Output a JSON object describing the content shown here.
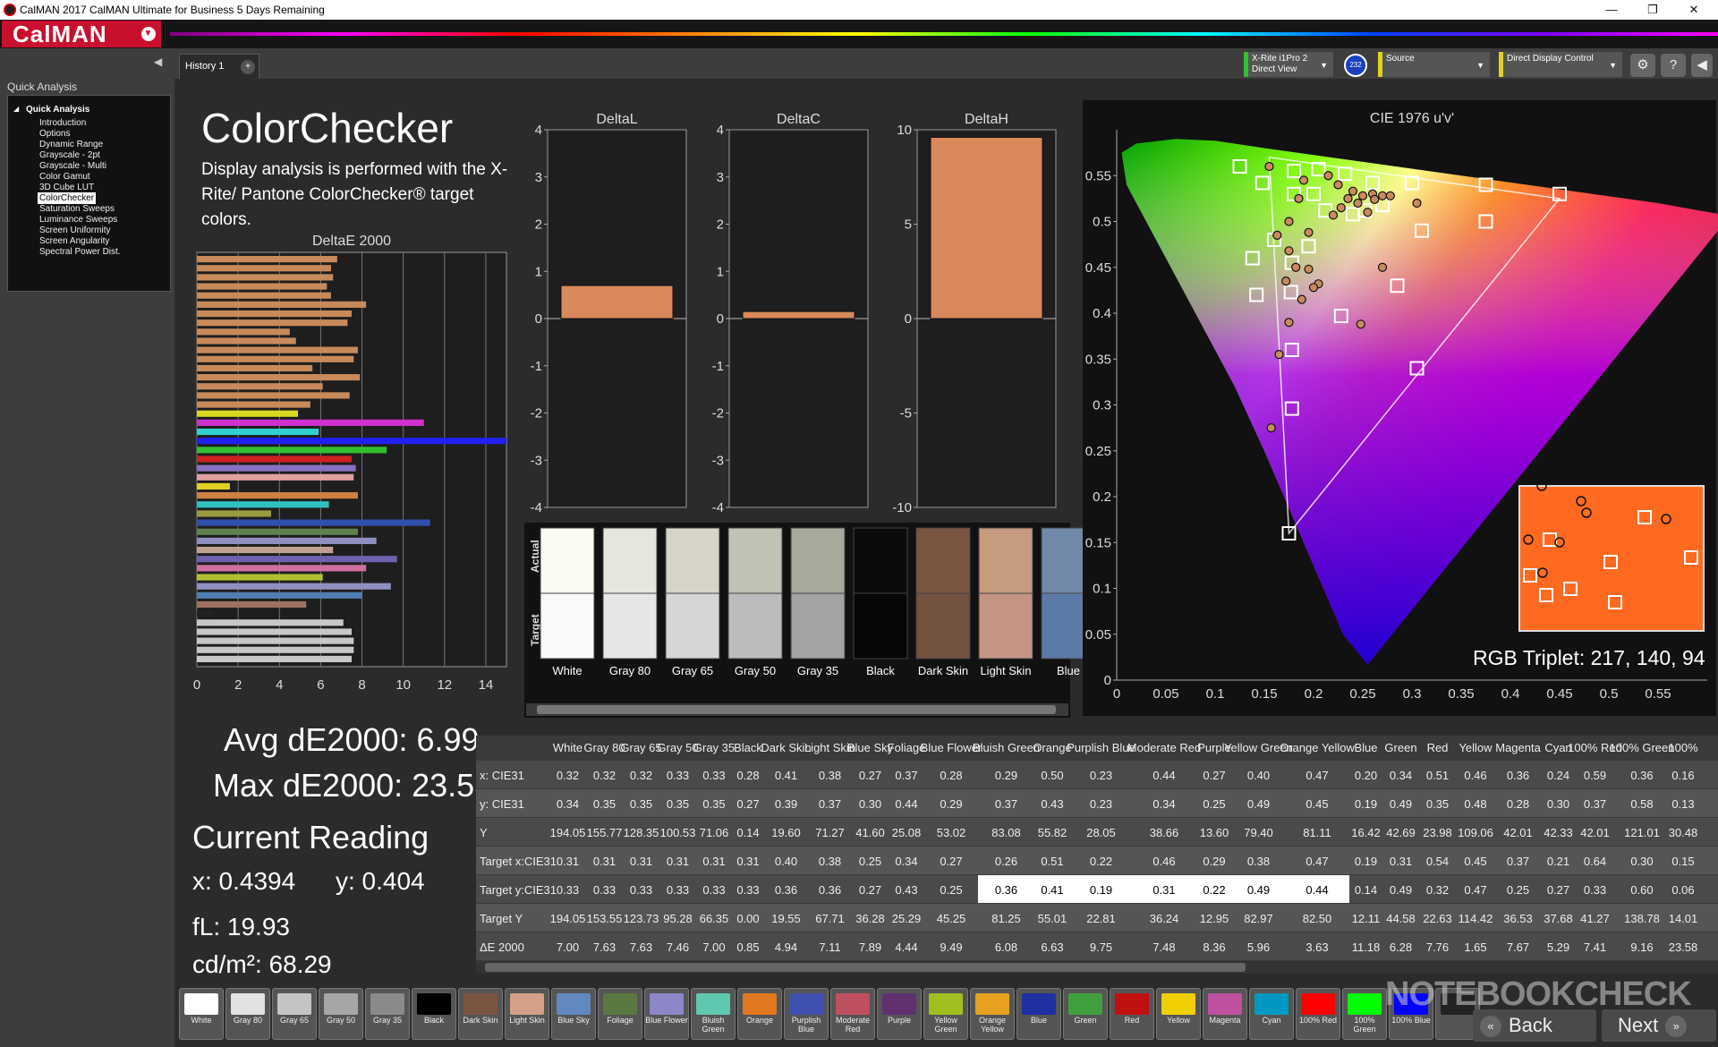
{
  "window": {
    "title": "CalMAN 2017 CalMAN Ultimate for Business 5 Days Remaining",
    "controls": [
      "—",
      "❐",
      "✕"
    ]
  },
  "logo": {
    "text": "CalMAN",
    "dropdown": "▼"
  },
  "sidebar": {
    "header": "Quick Analysis",
    "collapse": "◀",
    "root": "Quick Analysis",
    "items": [
      {
        "label": "Introduction"
      },
      {
        "label": "Options"
      },
      {
        "label": "Dynamic Range"
      },
      {
        "label": "Grayscale - 2pt"
      },
      {
        "label": "Grayscale - Multi"
      },
      {
        "label": "Color Gamut"
      },
      {
        "label": "3D Cube LUT"
      },
      {
        "label": "ColorChecker",
        "selected": true
      },
      {
        "label": "Saturation Sweeps"
      },
      {
        "label": "Luminance Sweeps"
      },
      {
        "label": "Screen Uniformity"
      },
      {
        "label": "Screen Angularity"
      },
      {
        "label": "Spectral Power Dist."
      }
    ]
  },
  "tabs": [
    {
      "label": "History 1"
    }
  ],
  "toolbar": {
    "meter": {
      "line1": "X-Rite i1Pro 2",
      "line2": "Direct View"
    },
    "badge": "232",
    "source": "Source",
    "display": "Direct Display Control",
    "buttons": [
      "⚙",
      "?",
      "◀"
    ]
  },
  "page": {
    "title": "ColorChecker",
    "description": "Display analysis is performed with the X-Rite/ Pantone ColorChecker® target colors."
  },
  "stats": {
    "avg": "Avg dE2000: 6.99",
    "max": "Max dE2000: 23.58",
    "current_heading": "Current Reading",
    "x": "x: 0.4394",
    "y": "y: 0.404",
    "fl": "fL: 19.93",
    "cdm2": "cd/m²: 68.29"
  },
  "chart_data": [
    {
      "type": "bar",
      "title": "DeltaE 2000",
      "orientation": "horizontal",
      "xlim": [
        0,
        15
      ],
      "xticks": [
        0,
        2,
        4,
        6,
        8,
        10,
        12,
        14
      ],
      "bars": [
        {
          "color": "#c88a5a",
          "value": 6.8
        },
        {
          "color": "#c88a5a",
          "value": 6.5
        },
        {
          "color": "#c88a5a",
          "value": 6.6
        },
        {
          "color": "#c88a5a",
          "value": 6.3
        },
        {
          "color": "#c88a5a",
          "value": 6.5
        },
        {
          "color": "#c88a5a",
          "value": 8.2
        },
        {
          "color": "#c88a5a",
          "value": 7.5
        },
        {
          "color": "#c88a5a",
          "value": 7.3
        },
        {
          "color": "#c88a5a",
          "value": 4.5
        },
        {
          "color": "#c88a5a",
          "value": 4.8
        },
        {
          "color": "#c88a5a",
          "value": 7.8
        },
        {
          "color": "#c88a5a",
          "value": 7.6
        },
        {
          "color": "#c88a5a",
          "value": 5.6
        },
        {
          "color": "#c88a5a",
          "value": 7.9
        },
        {
          "color": "#c88a5a",
          "value": 6.1
        },
        {
          "color": "#c88a5a",
          "value": 7.4
        },
        {
          "color": "#c88a5a",
          "value": 5.5
        },
        {
          "color": "#d8d820",
          "value": 4.9
        },
        {
          "color": "#d030d0",
          "value": 11.0
        },
        {
          "color": "#30d0d0",
          "value": 5.9
        },
        {
          "color": "#2020f0",
          "value": 15.0
        },
        {
          "color": "#30c030",
          "value": 9.2
        },
        {
          "color": "#d02020",
          "value": 7.5
        },
        {
          "color": "#8a70c0",
          "value": 7.7
        },
        {
          "color": "#e0a0a0",
          "value": 7.6
        },
        {
          "color": "#e0d020",
          "value": 1.6
        },
        {
          "color": "#d08040",
          "value": 7.8
        },
        {
          "color": "#30c0c0",
          "value": 6.4
        },
        {
          "color": "#9a9a40",
          "value": 3.6
        },
        {
          "color": "#3050b0",
          "value": 11.3
        },
        {
          "color": "#608050",
          "value": 7.8
        },
        {
          "color": "#9090c0",
          "value": 8.7
        },
        {
          "color": "#c0a090",
          "value": 6.6
        },
        {
          "color": "#7060b0",
          "value": 9.7
        },
        {
          "color": "#d070a0",
          "value": 8.2
        },
        {
          "color": "#b0c030",
          "value": 6.1
        },
        {
          "color": "#9090c0",
          "value": 9.4
        },
        {
          "color": "#5080b0",
          "value": 8.0
        },
        {
          "color": "#a07060",
          "value": 5.3
        },
        {
          "color": "#222222",
          "value": 0.8
        },
        {
          "color": "#c8c8c8",
          "value": 7.1
        },
        {
          "color": "#c8c8c8",
          "value": 7.5
        },
        {
          "color": "#c8c8c8",
          "value": 7.6
        },
        {
          "color": "#c8c8c8",
          "value": 7.6
        },
        {
          "color": "#c8c8c8",
          "value": 7.5
        }
      ]
    },
    {
      "type": "bar",
      "title": "DeltaL",
      "ylim": [
        -4,
        4
      ],
      "yticks": [
        4,
        3,
        2,
        1,
        0,
        -1,
        -2,
        -3,
        -4
      ],
      "values": [
        0.7
      ]
    },
    {
      "type": "bar",
      "title": "DeltaC",
      "ylim": [
        -4,
        4
      ],
      "yticks": [
        4,
        3,
        2,
        1,
        0,
        -1,
        -2,
        -3,
        -4
      ],
      "values": [
        0.15
      ]
    },
    {
      "type": "bar",
      "title": "DeltaH",
      "ylim": [
        -10,
        10
      ],
      "yticks": [
        10,
        5,
        0,
        -5,
        -10
      ],
      "values": [
        9.6
      ]
    },
    {
      "type": "scatter",
      "title": "CIE 1976 u'v'",
      "xlim": [
        0,
        0.6
      ],
      "ylim": [
        0,
        0.6
      ],
      "xticks": [
        "0",
        "0.05",
        "0.1",
        "0.15",
        "0.2",
        "0.25",
        "0.3",
        "0.35",
        "0.4",
        "0.45",
        "0.5",
        "0.55"
      ],
      "yticks": [
        "0.55",
        "0.5",
        "0.45",
        "0.4",
        "0.35",
        "0.3",
        "0.25",
        "0.2",
        "0.15",
        "0.1",
        "0.05",
        "0"
      ],
      "targets": [
        [
          0.125,
          0.56
        ],
        [
          0.18,
          0.555
        ],
        [
          0.205,
          0.557
        ],
        [
          0.232,
          0.552
        ],
        [
          0.26,
          0.542
        ],
        [
          0.3,
          0.542
        ],
        [
          0.375,
          0.54
        ],
        [
          0.45,
          0.53
        ],
        [
          0.148,
          0.542
        ],
        [
          0.18,
          0.53
        ],
        [
          0.2,
          0.53
        ],
        [
          0.212,
          0.512
        ],
        [
          0.24,
          0.508
        ],
        [
          0.252,
          0.512
        ],
        [
          0.27,
          0.518
        ],
        [
          0.31,
          0.49
        ],
        [
          0.375,
          0.5
        ],
        [
          0.16,
          0.48
        ],
        [
          0.138,
          0.46
        ],
        [
          0.178,
          0.455
        ],
        [
          0.195,
          0.473
        ],
        [
          0.142,
          0.42
        ],
        [
          0.177,
          0.423
        ],
        [
          0.285,
          0.43
        ],
        [
          0.228,
          0.397
        ],
        [
          0.178,
          0.36
        ],
        [
          0.305,
          0.34
        ],
        [
          0.178,
          0.296
        ],
        [
          0.175,
          0.16
        ]
      ],
      "actual": [
        [
          0.155,
          0.56
        ],
        [
          0.19,
          0.545
        ],
        [
          0.215,
          0.55
        ],
        [
          0.225,
          0.54
        ],
        [
          0.24,
          0.533
        ],
        [
          0.26,
          0.53
        ],
        [
          0.27,
          0.528
        ],
        [
          0.305,
          0.52
        ],
        [
          0.228,
          0.515
        ],
        [
          0.235,
          0.525
        ],
        [
          0.245,
          0.52
        ],
        [
          0.25,
          0.528
        ],
        [
          0.262,
          0.524
        ],
        [
          0.255,
          0.51
        ],
        [
          0.278,
          0.528
        ],
        [
          0.185,
          0.525
        ],
        [
          0.22,
          0.507
        ],
        [
          0.175,
          0.5
        ],
        [
          0.163,
          0.485
        ],
        [
          0.195,
          0.488
        ],
        [
          0.175,
          0.468
        ],
        [
          0.182,
          0.45
        ],
        [
          0.195,
          0.448
        ],
        [
          0.27,
          0.45
        ],
        [
          0.205,
          0.432
        ],
        [
          0.172,
          0.435
        ],
        [
          0.2,
          0.428
        ],
        [
          0.188,
          0.415
        ],
        [
          0.175,
          0.39
        ],
        [
          0.248,
          0.388
        ],
        [
          0.165,
          0.355
        ],
        [
          0.157,
          0.275
        ]
      ],
      "annotation": "RGB Triplet: 217, 140, 94"
    }
  ],
  "swatch_strip": {
    "labels": [
      {
        "text": "White",
        "color": "#fbfbf2"
      },
      {
        "text": "Gray 80",
        "color": "#e6e6dc"
      },
      {
        "text": "Gray 65",
        "color": "#d6d5c8"
      },
      {
        "text": "Gray 50",
        "color": "#c2c2b4"
      },
      {
        "text": "Gray 35",
        "color": "#a9a99c"
      },
      {
        "text": "Black",
        "color": "#0b0b0c"
      },
      {
        "text": "Dark Skin",
        "color": "#7a5642"
      },
      {
        "text": "Light Skin",
        "color": "#c79b80"
      },
      {
        "text": "Blue",
        "color": "#7089a8"
      }
    ],
    "target_colors": [
      "#fafafa",
      "#e6e6e6",
      "#d6d6d6",
      "#bcbcbc",
      "#a3a3a3",
      "#060606",
      "#73523f",
      "#c49484",
      "#5c7aa8"
    ],
    "actual_label": "Actual",
    "target_label": "Target"
  },
  "table": {
    "columns": [
      "White",
      "Gray 80",
      "Gray 65",
      "Gray 50",
      "Gray 35",
      "Black",
      "Dark Skin",
      "Light Skin",
      "Blue Sky",
      "Foliage",
      "Blue Flower",
      "Bluish Green",
      "Orange",
      "Purplish Blue",
      "Moderate Red",
      "Purple",
      "Yellow Green",
      "Orange Yellow",
      "Blue",
      "Green",
      "Red",
      "Yellow",
      "Magenta",
      "Cyan",
      "100% Red",
      "100% Green",
      "100%"
    ],
    "rows": [
      {
        "label": "x: CIE31",
        "values": [
          "0.32",
          "0.32",
          "0.32",
          "0.33",
          "0.33",
          "0.28",
          "0.41",
          "0.38",
          "0.27",
          "0.37",
          "0.28",
          "0.29",
          "0.50",
          "0.23",
          "0.44",
          "0.27",
          "0.40",
          "0.47",
          "0.20",
          "0.34",
          "0.51",
          "0.46",
          "0.36",
          "0.24",
          "0.59",
          "0.36",
          "0.16"
        ]
      },
      {
        "label": "y: CIE31",
        "values": [
          "0.34",
          "0.35",
          "0.35",
          "0.35",
          "0.35",
          "0.27",
          "0.39",
          "0.37",
          "0.30",
          "0.44",
          "0.29",
          "0.37",
          "0.43",
          "0.23",
          "0.34",
          "0.25",
          "0.49",
          "0.45",
          "0.19",
          "0.49",
          "0.35",
          "0.48",
          "0.28",
          "0.30",
          "0.37",
          "0.58",
          "0.13"
        ]
      },
      {
        "label": "Y",
        "values": [
          "194.05",
          "155.77",
          "128.35",
          "100.53",
          "71.06",
          "0.14",
          "19.60",
          "71.27",
          "41.60",
          "25.08",
          "53.02",
          "83.08",
          "55.82",
          "28.05",
          "38.66",
          "13.60",
          "79.40",
          "81.11",
          "16.42",
          "42.69",
          "23.98",
          "109.06",
          "42.01",
          "42.33",
          "42.01",
          "121.01",
          "30.48"
        ]
      },
      {
        "label": "Target x:CIE31",
        "values": [
          "0.31",
          "0.31",
          "0.31",
          "0.31",
          "0.31",
          "0.31",
          "0.40",
          "0.38",
          "0.25",
          "0.34",
          "0.27",
          "0.26",
          "0.51",
          "0.22",
          "0.46",
          "0.29",
          "0.38",
          "0.47",
          "0.19",
          "0.31",
          "0.54",
          "0.45",
          "0.37",
          "0.21",
          "0.64",
          "0.30",
          "0.15"
        ]
      },
      {
        "label": "Target y:CIE31",
        "values": [
          "0.33",
          "0.33",
          "0.33",
          "0.33",
          "0.33",
          "0.33",
          "0.36",
          "0.36",
          "0.27",
          "0.43",
          "0.25",
          "0.36",
          "0.41",
          "0.19",
          "0.31",
          "0.22",
          "0.49",
          "0.44",
          "0.14",
          "0.49",
          "0.32",
          "0.47",
          "0.25",
          "0.27",
          "0.33",
          "0.60",
          "0.06"
        ],
        "highlight": [
          11,
          12,
          13,
          14,
          15,
          16,
          17
        ]
      },
      {
        "label": "Target Y",
        "values": [
          "194.05",
          "153.55",
          "123.73",
          "95.28",
          "66.35",
          "0.00",
          "19.55",
          "67.71",
          "36.28",
          "25.29",
          "45.25",
          "81.25",
          "55.01",
          "22.81",
          "36.24",
          "12.95",
          "82.97",
          "82.50",
          "12.11",
          "44.58",
          "22.63",
          "114.42",
          "36.53",
          "37.68",
          "41.27",
          "138.78",
          "14.01"
        ]
      },
      {
        "label": "ΔE 2000",
        "values": [
          "7.00",
          "7.63",
          "7.63",
          "7.46",
          "7.00",
          "0.85",
          "4.94",
          "7.11",
          "7.89",
          "4.44",
          "9.49",
          "6.08",
          "6.63",
          "9.75",
          "7.48",
          "8.36",
          "5.96",
          "3.63",
          "11.18",
          "6.28",
          "7.76",
          "1.65",
          "7.67",
          "5.29",
          "7.41",
          "9.16",
          "23.58"
        ]
      }
    ]
  },
  "bottom_swatches": [
    {
      "label": "White",
      "color": "#ffffff"
    },
    {
      "label": "Gray 80",
      "color": "#e2e2e2"
    },
    {
      "label": "Gray 65",
      "color": "#c4c4c4"
    },
    {
      "label": "Gray 50",
      "color": "#a6a6a6"
    },
    {
      "label": "Gray 35",
      "color": "#8a8a8a"
    },
    {
      "label": "Black",
      "color": "#000000"
    },
    {
      "label": "Dark Skin",
      "color": "#7a5642"
    },
    {
      "label": "Light Skin",
      "color": "#d4a088"
    },
    {
      "label": "Blue Sky",
      "color": "#6288c0"
    },
    {
      "label": "Foliage",
      "color": "#5a7840"
    },
    {
      "label": "Blue Flower",
      "color": "#8c88c8"
    },
    {
      "label": "Bluish Green",
      "color": "#60c8b0"
    },
    {
      "label": "Orange",
      "color": "#e07820"
    },
    {
      "label": "Purplish Blue",
      "color": "#4050b0"
    },
    {
      "label": "Moderate Red",
      "color": "#c05060"
    },
    {
      "label": "Purple",
      "color": "#603070"
    },
    {
      "label": "Yellow Green",
      "color": "#a0c020"
    },
    {
      "label": "Orange Yellow",
      "color": "#e8a020"
    },
    {
      "label": "Blue",
      "color": "#2030a0"
    },
    {
      "label": "Green",
      "color": "#40a040"
    },
    {
      "label": "Red",
      "color": "#c01010"
    },
    {
      "label": "Yellow",
      "color": "#f0d000"
    },
    {
      "label": "Magenta",
      "color": "#c050a0"
    },
    {
      "label": "Cyan",
      "color": "#0098c0"
    },
    {
      "label": "100% Red",
      "color": "#ff0000"
    },
    {
      "label": "100% Green",
      "color": "#00ff00"
    },
    {
      "label": "100% Blue",
      "color": "#0000ff"
    },
    {
      "label": "",
      "color": "#222222"
    }
  ],
  "nav": {
    "back": "Back",
    "next": "Next",
    "back_icon": "«",
    "next_icon": "»"
  },
  "watermark": "NOTEBOOKCHECK"
}
